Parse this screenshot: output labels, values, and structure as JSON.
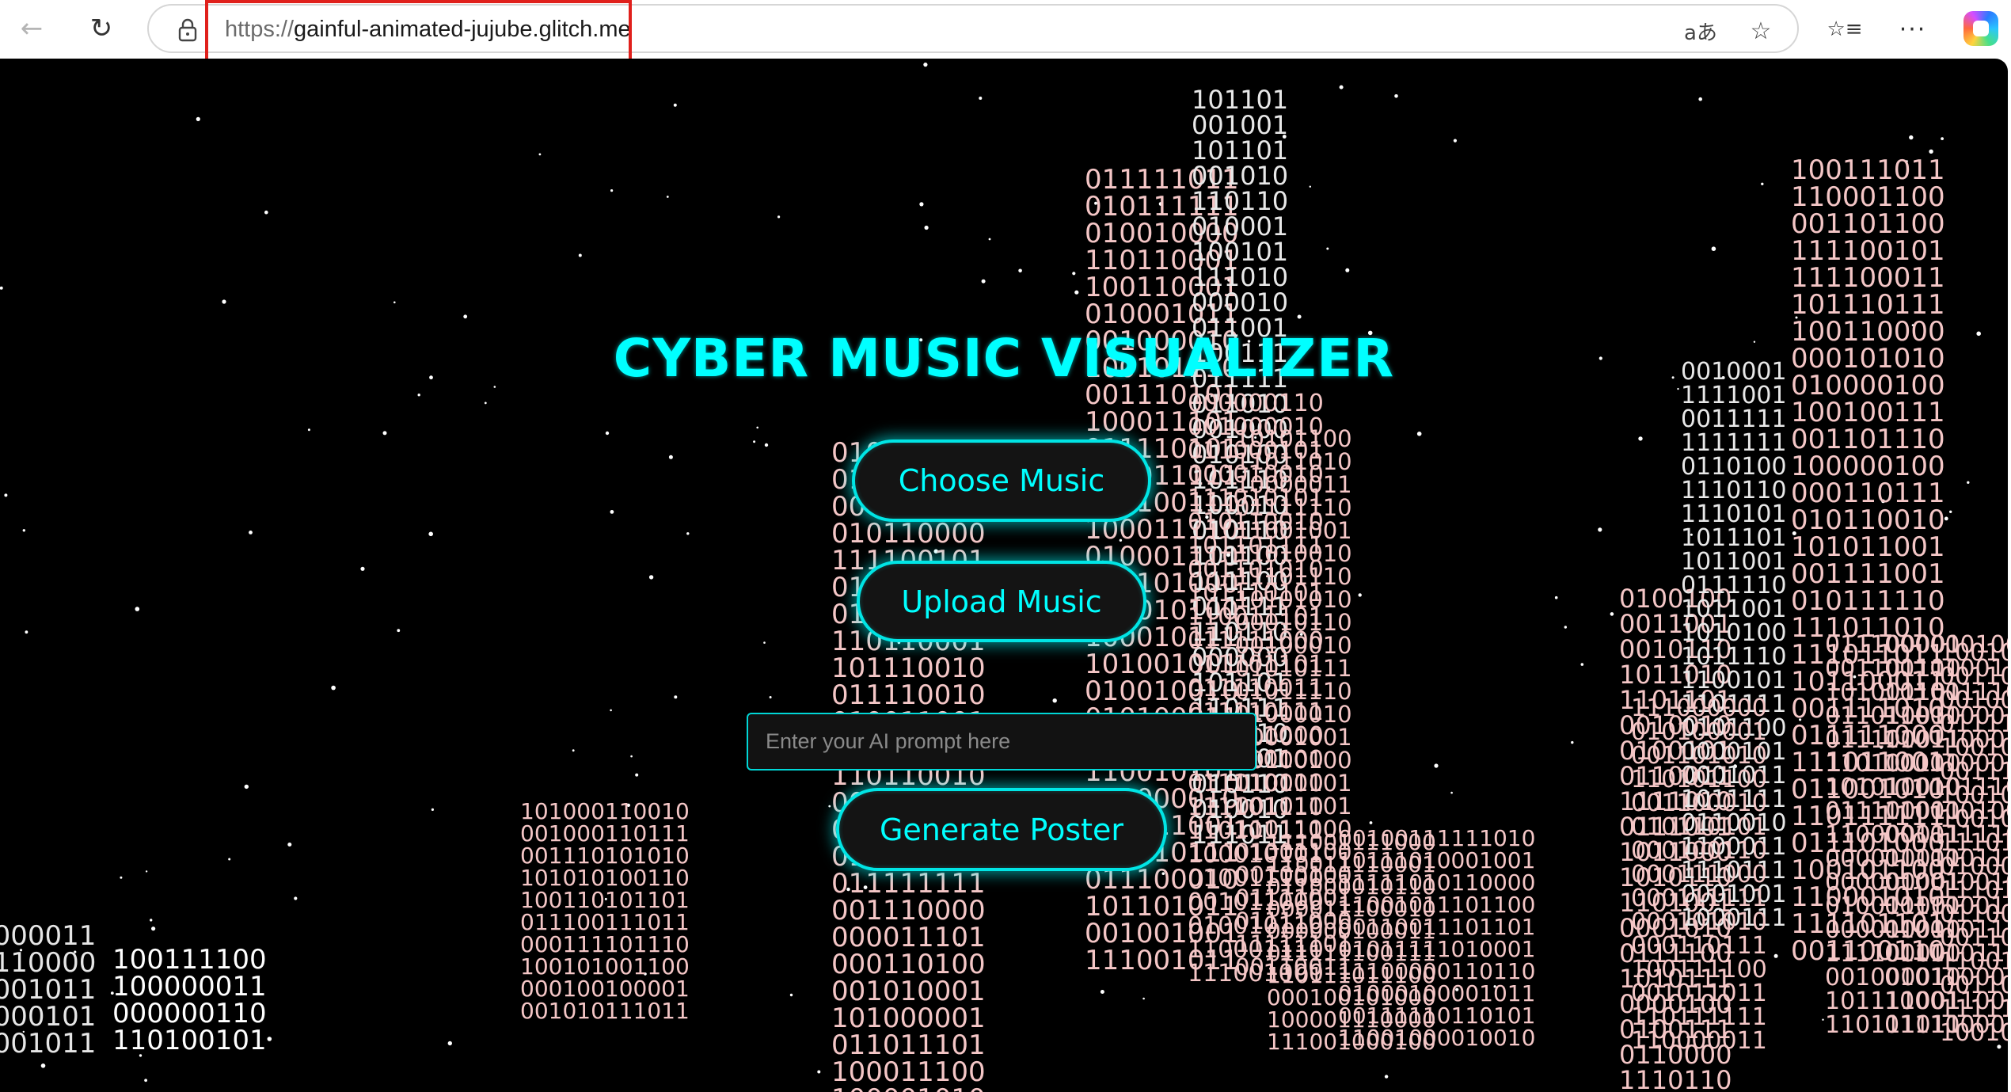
{
  "browser": {
    "url_scheme": "https://",
    "url_host": "gainful-animated-jujube.glitch.me",
    "icons": {
      "back": "back-arrow-icon",
      "reload": "reload-icon",
      "lock": "lock-icon",
      "translate": "translate-icon",
      "favorite": "star-icon",
      "favorites_list": "favorites-icon",
      "menu": "more-icon",
      "copilot": "copilot-icon"
    },
    "glyphs": {
      "back": "←",
      "reload": "↻",
      "translate": "aあ",
      "star": "☆",
      "favorites": "☆≡",
      "more": "···"
    },
    "highlight_color": "#e0201c"
  },
  "page": {
    "title": "CYBER MUSIC VISUALIZER",
    "choose_music": "Choose Music",
    "upload_music": "Upload Music",
    "prompt_placeholder": "Enter your AI prompt here",
    "prompt_value": "",
    "generate_poster": "Generate Poster",
    "accent_color": "#00ffff",
    "background_color": "#000000",
    "binary_color": "#f4c6c6"
  }
}
